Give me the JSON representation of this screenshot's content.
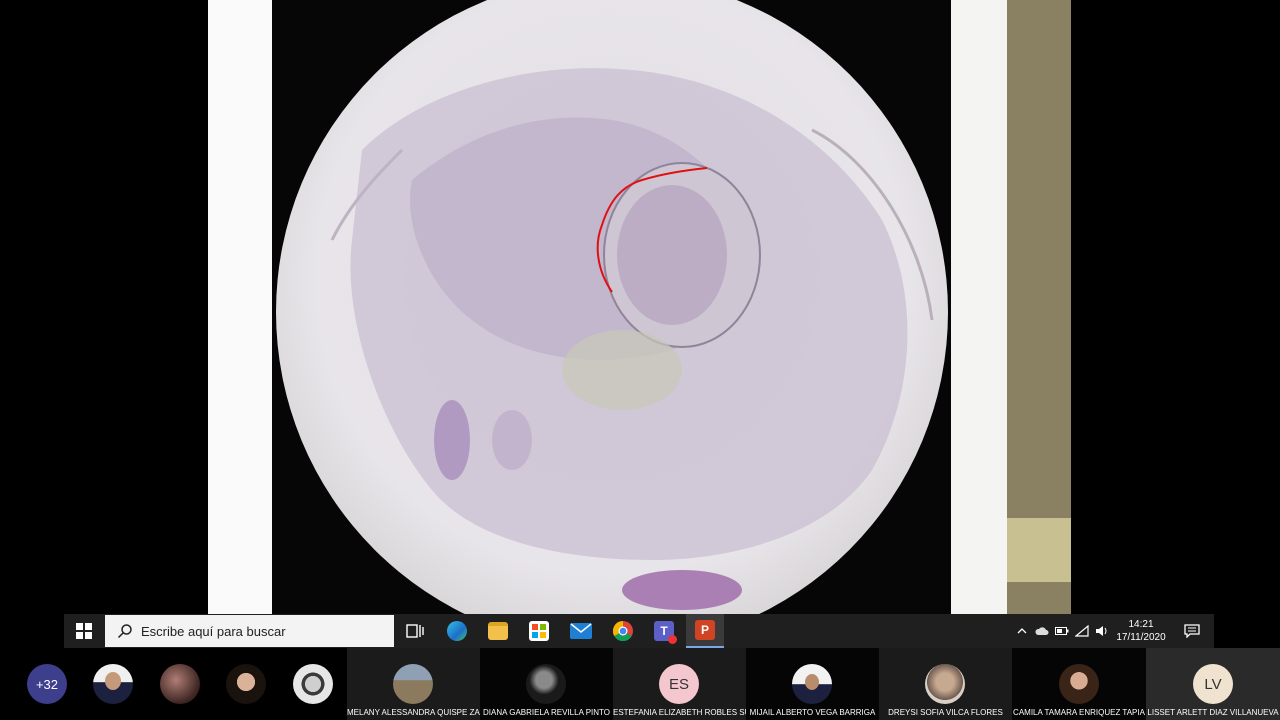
{
  "taskbar": {
    "search_placeholder": "Escribe aquí para buscar",
    "apps": [
      "task-view",
      "edge",
      "file-explorer",
      "store",
      "mail",
      "chrome",
      "teams",
      "powerpoint"
    ],
    "tray_icons": [
      "chevron-up-icon",
      "cloud-icon",
      "battery-icon",
      "wifi-icon",
      "volume-icon"
    ],
    "time": "14:21",
    "date": "17/11/2020",
    "accent": "#7aa7e8"
  },
  "participants": {
    "more_count": "+32",
    "people": [
      {
        "name": "MELANY ALESSANDRA QUISPE ZA..."
      },
      {
        "name": "DIANA GABRIELA REVILLA PINTO"
      },
      {
        "name": "ESTEFANIA ELIZABETH ROBLES SUNI",
        "initials": "ES"
      },
      {
        "name": "MIJAIL ALBERTO VEGA BARRIGA"
      },
      {
        "name": "DREYSI SOFIA VILCA FLORES"
      },
      {
        "name": "CAMILA TAMARA ENRIQUEZ TAPIA"
      },
      {
        "name": "LISSET ARLETT DIAZ VILLANUEVA",
        "initials": "LV"
      }
    ]
  }
}
